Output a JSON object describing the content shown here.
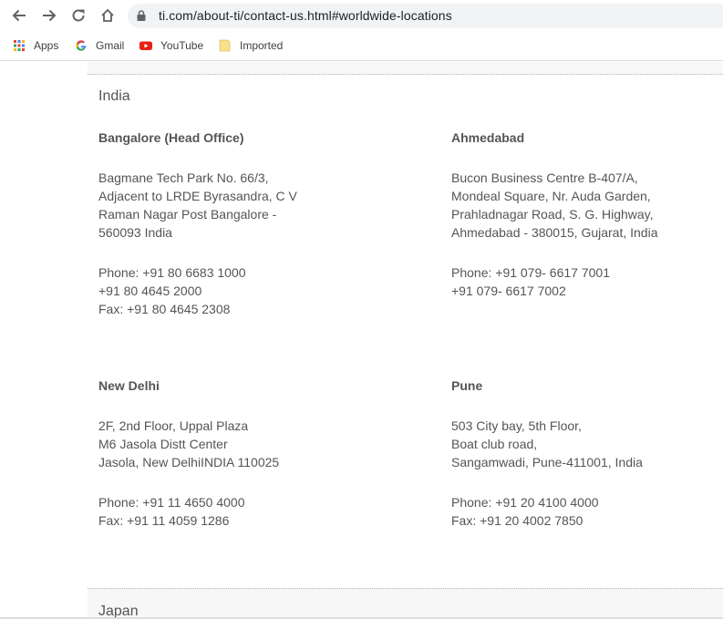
{
  "browser": {
    "url": "ti.com/about-ti/contact-us.html#worldwide-locations",
    "nav_icons": [
      "back-arrow-icon",
      "forward-arrow-icon",
      "reload-icon",
      "home-icon"
    ],
    "bookmarks": [
      {
        "label": "Apps",
        "icon": "apps-grid-icon"
      },
      {
        "label": "Gmail",
        "icon": "google-g-icon"
      },
      {
        "label": "YouTube",
        "icon": "youtube-icon"
      },
      {
        "label": "Imported",
        "icon": "folder-icon"
      }
    ]
  },
  "page": {
    "region_title": "India",
    "offices": [
      {
        "name": "Bangalore (Head Office)",
        "address": "Bagmane Tech Park No. 66/3,\nAdjacent to LRDE Byrasandra, C V\nRaman Nagar Post Bangalore -\n560093 India",
        "contact": "Phone: +91 80 6683 1000\n+91 80 4645 2000\nFax: +91 80 4645 2308"
      },
      {
        "name": "Ahmedabad",
        "address": "Bucon Business Centre B-407/A,\nMondeal Square, Nr. Auda Garden,\nPrahladnagar Road, S. G. Highway,\nAhmedabad - 380015, Gujarat, India",
        "contact": "Phone: +91 079- 6617 7001\n+91 079- 6617 7002"
      },
      {
        "name": "New Delhi",
        "address": "2F, 2nd Floor, Uppal Plaza\nM6 Jasola Distt Center\nJasola, New DelhiINDIA 110025",
        "contact": "Phone: +91 11 4650 4000\nFax: +91 11 4059 1286"
      },
      {
        "name": "Pune",
        "address": "503 City bay, 5th Floor,\nBoat club road,\nSangamwadi, Pune-411001, India",
        "contact": "Phone: +91 20 4100 4000\nFax: +91 20 4002 7850"
      }
    ],
    "next_region_title": "Japan"
  }
}
